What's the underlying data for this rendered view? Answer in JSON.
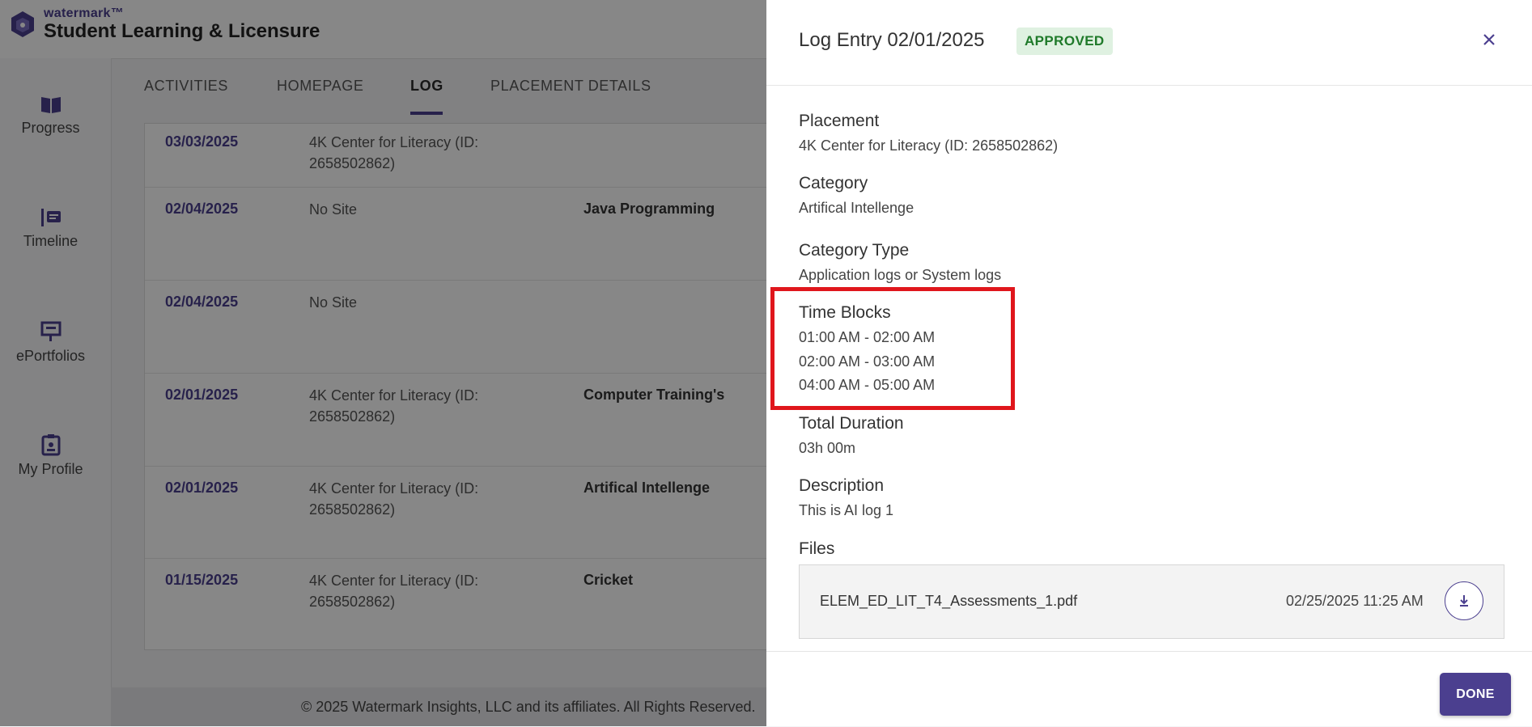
{
  "app": {
    "brand_small": "watermark™",
    "brand_title": "Student Learning & Licensure"
  },
  "sidebar": {
    "items": [
      {
        "label": "Progress",
        "icon": "book-icon"
      },
      {
        "label": "Timeline",
        "icon": "timeline-icon"
      },
      {
        "label": "ePortfolios",
        "icon": "presentation-icon"
      },
      {
        "label": "My Profile",
        "icon": "badge-icon"
      }
    ]
  },
  "tabs": [
    {
      "label": "ACTIVITIES"
    },
    {
      "label": "HOMEPAGE"
    },
    {
      "label": "LOG",
      "active": true
    },
    {
      "label": "PLACEMENT DETAILS"
    }
  ],
  "log_rows": [
    {
      "date": "03/03/2025",
      "site": "4K Center for Literacy (ID: 2658502862)",
      "category": ""
    },
    {
      "date": "02/04/2025",
      "site": "No Site",
      "category": "Java Programming"
    },
    {
      "date": "02/04/2025",
      "site": "No Site",
      "category": ""
    },
    {
      "date": "02/01/2025",
      "site": "4K Center for Literacy (ID: 2658502862)",
      "category": "Computer Training's"
    },
    {
      "date": "02/01/2025",
      "site": "4K Center for Literacy (ID: 2658502862)",
      "category": "Artifical Intellenge"
    },
    {
      "date": "01/15/2025",
      "site": "4K Center for Literacy (ID: 2658502862)",
      "category": "Cricket"
    }
  ],
  "footer": {
    "text": "© 2025 Watermark Insights, LLC and its affiliates. All Rights Reserved."
  },
  "drawer": {
    "title": "Log Entry 02/01/2025",
    "status": "APPROVED",
    "placement_label": "Placement",
    "placement_value": "4K Center for Literacy (ID: 2658502862)",
    "category_label": "Category",
    "category_value": "Artifical Intellenge",
    "category_type_label": "Category Type",
    "category_type_value": "Application logs or System logs",
    "time_blocks_label": "Time Blocks",
    "time_blocks": [
      "01:00 AM - 02:00 AM",
      "02:00 AM - 03:00 AM",
      "04:00 AM - 05:00 AM"
    ],
    "total_duration_label": "Total Duration",
    "total_duration_value": "03h 00m",
    "description_label": "Description",
    "description_value": "This is AI log 1",
    "files_label": "Files",
    "file": {
      "name": "ELEM_ED_LIT_T4_Assessments_1.pdf",
      "date": "02/25/2025 11:25 AM"
    },
    "done_label": "DONE"
  },
  "colors": {
    "accent": "#4b3f8f",
    "status_bg": "#dff1e1",
    "status_text": "#1f7a2a",
    "highlight": "#e0161c"
  }
}
